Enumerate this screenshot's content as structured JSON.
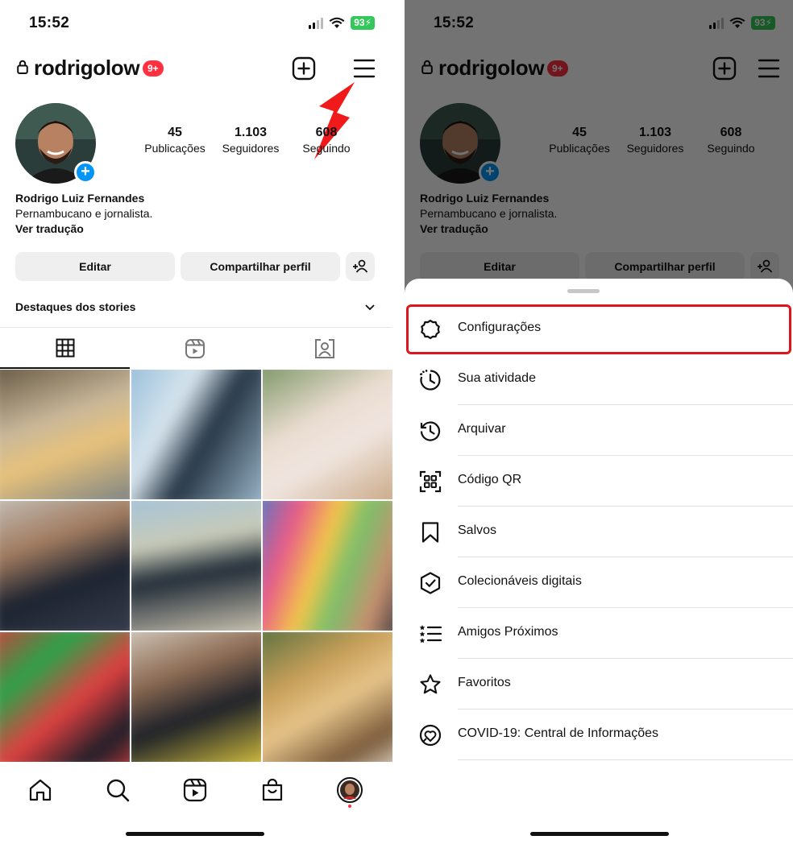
{
  "status": {
    "time": "15:52",
    "battery": "93"
  },
  "profile": {
    "username": "rodrigolow",
    "notif_badge": "9+",
    "stats": [
      {
        "num": "45",
        "label": "Publicações"
      },
      {
        "num": "1.103",
        "label": "Seguidores"
      },
      {
        "num": "608",
        "label": "Seguindo"
      }
    ],
    "name": "Rodrigo Luiz Fernandes",
    "bio": "Pernambucano e jornalista.",
    "translate": "Ver tradução",
    "edit_label": "Editar",
    "share_label": "Compartilhar perfil",
    "highlights_label": "Destaques dos stories"
  },
  "menu": {
    "items": [
      {
        "label": "Configurações",
        "icon": "settings-icon"
      },
      {
        "label": "Sua atividade",
        "icon": "activity-icon"
      },
      {
        "label": "Arquivar",
        "icon": "archive-icon"
      },
      {
        "label": "Código QR",
        "icon": "qr-code-icon"
      },
      {
        "label": "Salvos",
        "icon": "bookmark-icon"
      },
      {
        "label": "Colecionáveis digitais",
        "icon": "shield-check-icon"
      },
      {
        "label": "Amigos Próximos",
        "icon": "close-friends-list-icon"
      },
      {
        "label": "Favoritos",
        "icon": "star-icon"
      },
      {
        "label": "COVID-19: Central de Informações",
        "icon": "covid-info-icon"
      }
    ]
  },
  "colors": {
    "accent_blue": "#0095f6",
    "badge_red": "#ff3040",
    "annotation_red": "#e0151b",
    "battery_green": "#34c759"
  }
}
